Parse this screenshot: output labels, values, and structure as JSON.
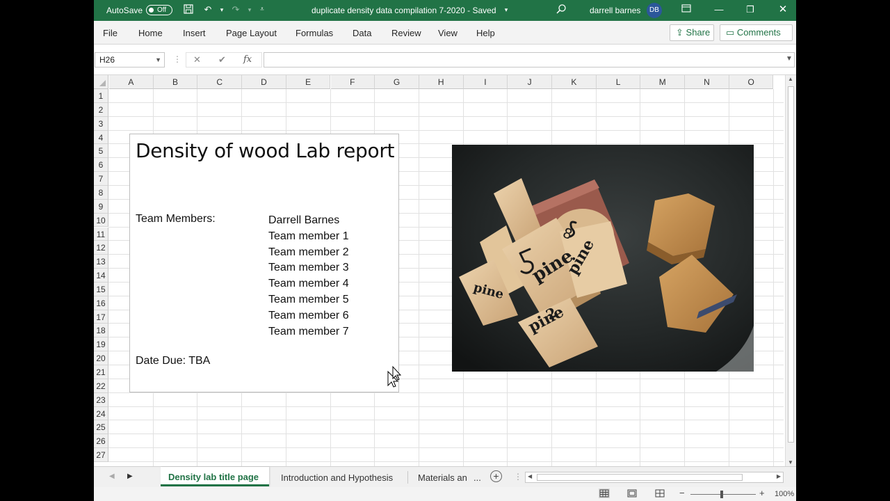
{
  "titlebar": {
    "autosave_label": "AutoSave",
    "autosave_state": "Off",
    "file_title": "duplicate density data compilation 7-2020  -  Saved",
    "user_name": "darrell barnes",
    "user_initials": "DB"
  },
  "ribbon": {
    "tabs": [
      "File",
      "Home",
      "Insert",
      "Page Layout",
      "Formulas",
      "Data",
      "Review",
      "View",
      "Help"
    ],
    "share_label": "Share",
    "comments_label": "Comments"
  },
  "formula_bar": {
    "name_box": "H26",
    "formula": ""
  },
  "grid": {
    "columns": [
      "A",
      "B",
      "C",
      "D",
      "E",
      "F",
      "G",
      "H",
      "I",
      "J",
      "K",
      "L",
      "M",
      "N",
      "O"
    ],
    "rows": [
      "1",
      "2",
      "3",
      "4",
      "5",
      "6",
      "7",
      "8",
      "9",
      "10",
      "11",
      "12",
      "13",
      "14",
      "15",
      "16",
      "17",
      "18",
      "19",
      "20",
      "21",
      "22",
      "23",
      "24",
      "25",
      "26",
      "27"
    ]
  },
  "textbox": {
    "title": "Density of wood Lab report",
    "team_label": "Team Members:",
    "members": [
      "Darrell Barnes",
      "Team member 1",
      "Team member 2",
      "Team member 3",
      "Team member 4",
      "Team member 5",
      "Team member 6",
      "Team member 7"
    ],
    "date_due": "Date Due: TBA"
  },
  "photo": {
    "block_labels": [
      "5",
      "pine",
      "pine",
      "2",
      "pine",
      "8",
      "pine"
    ]
  },
  "sheets": {
    "tabs": [
      "Density lab title page",
      "Introduction and Hypothesis",
      "Materials an"
    ],
    "active": "Density lab title page"
  },
  "status": {
    "zoom": "100%"
  },
  "colors": {
    "excel_green": "#217346",
    "avatar_blue": "#2b579a"
  }
}
